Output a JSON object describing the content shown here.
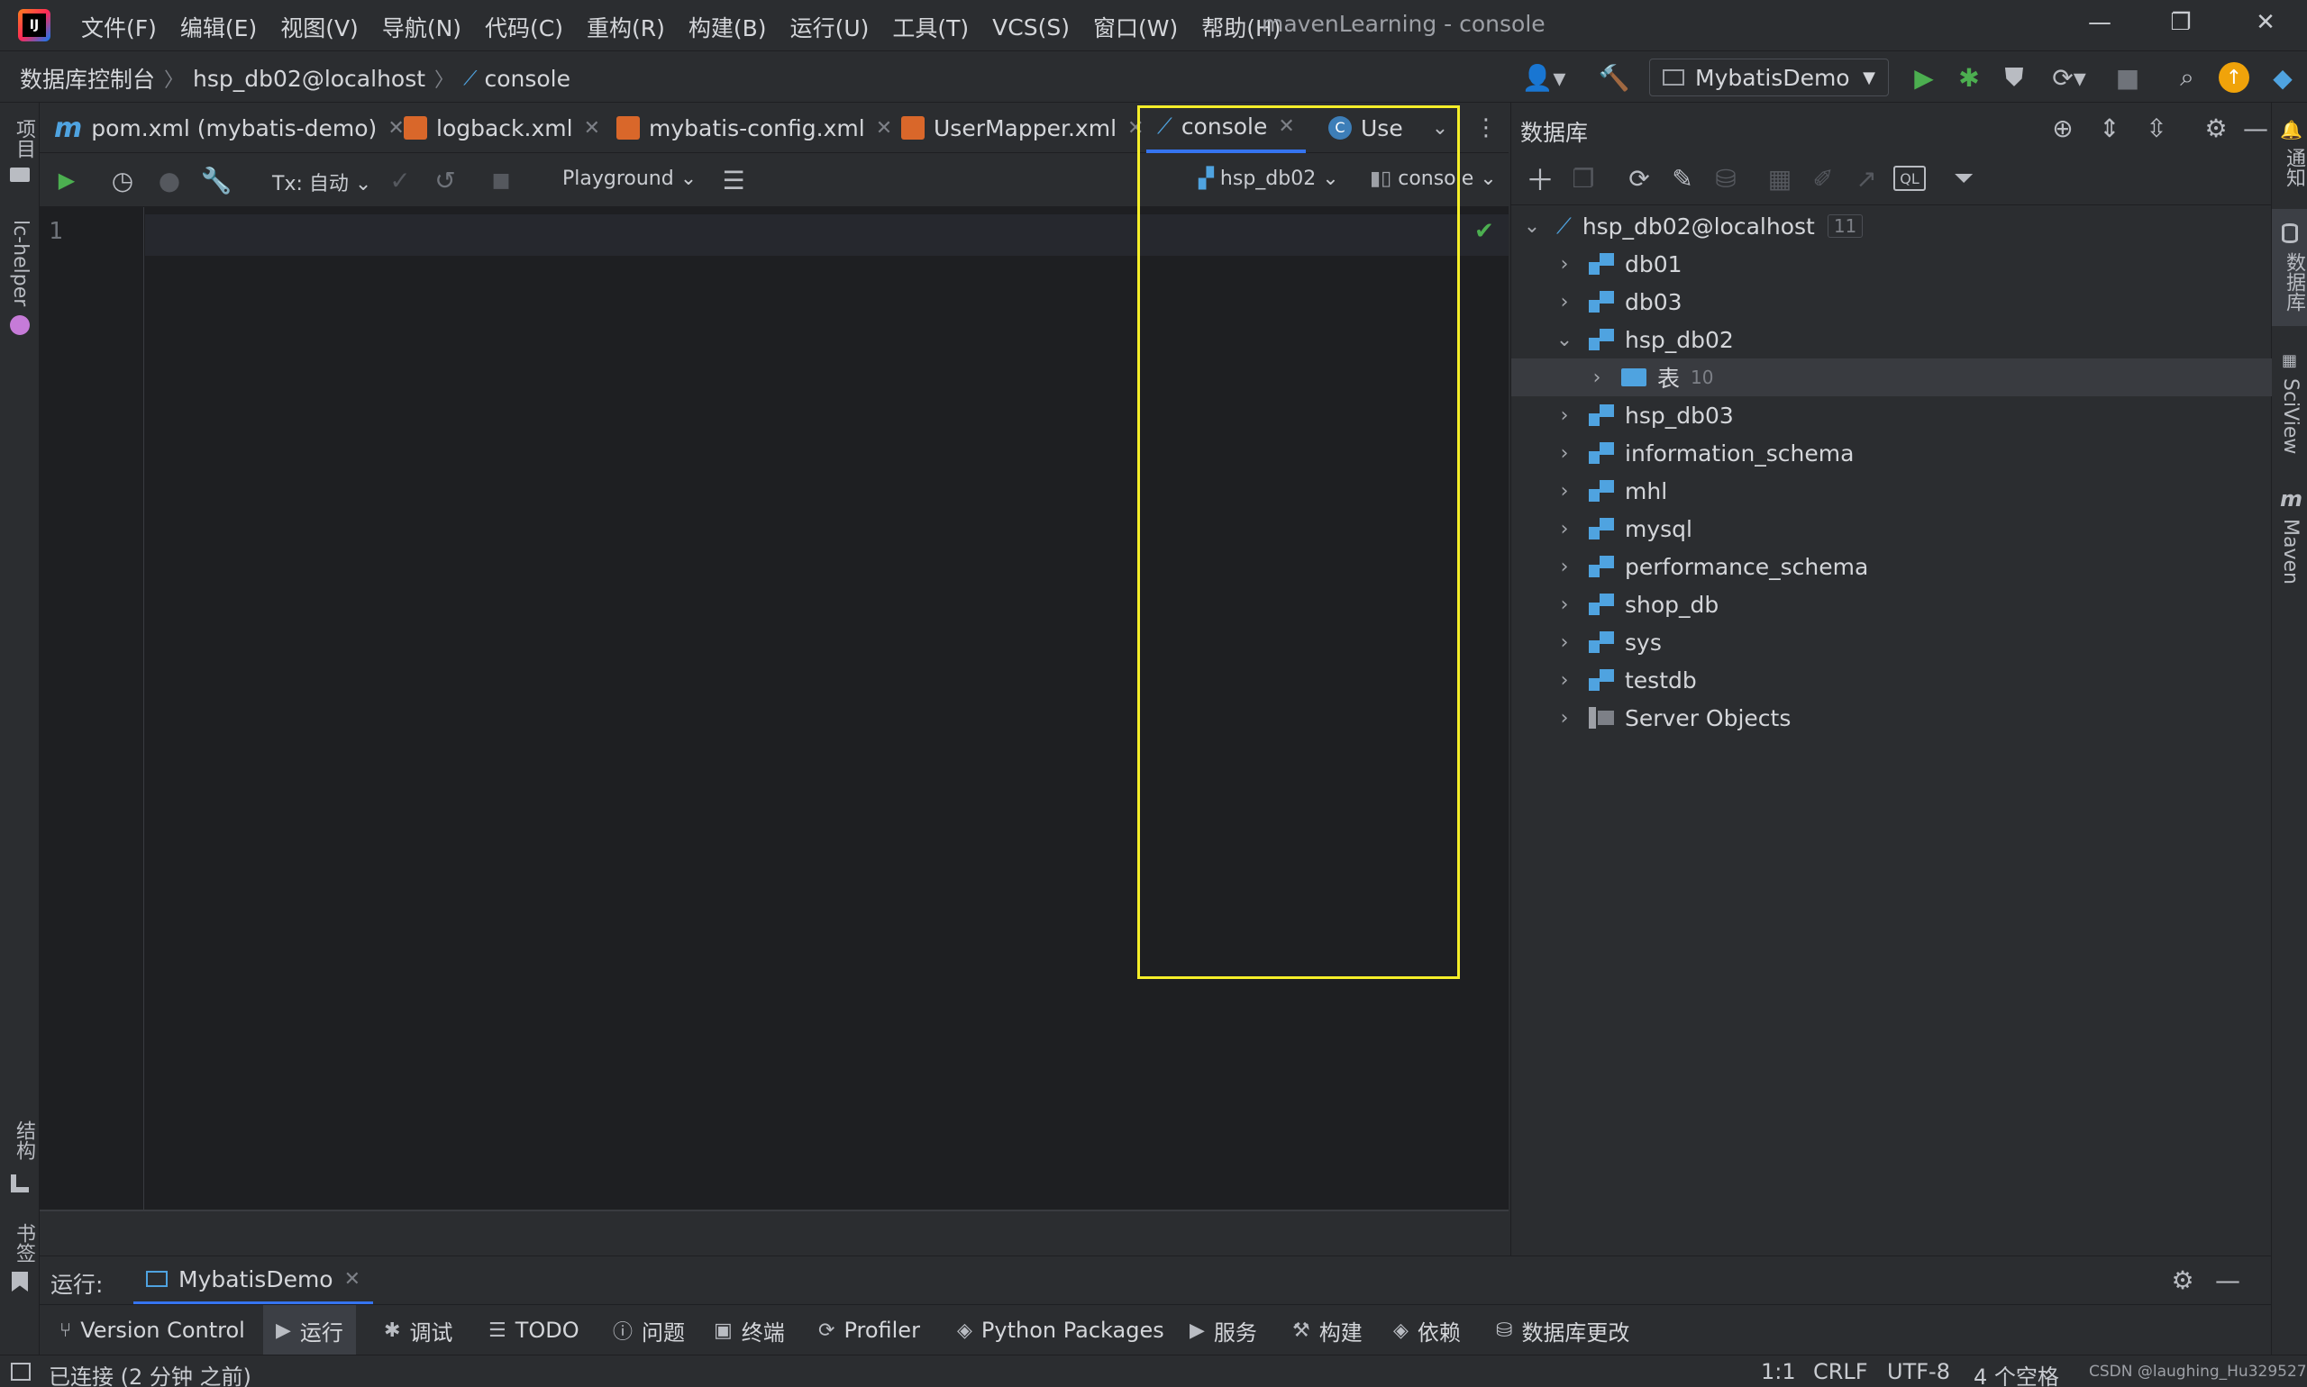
{
  "window": {
    "title": "mavenLearning - console",
    "menu": [
      "文件(F)",
      "编辑(E)",
      "视图(V)",
      "导航(N)",
      "代码(C)",
      "重构(R)",
      "构建(B)",
      "运行(U)",
      "工具(T)",
      "VCS(S)",
      "窗口(W)",
      "帮助(H)"
    ]
  },
  "breadcrumb": [
    "数据库控制台",
    "hsp_db02@localhost",
    "console"
  ],
  "run_config": "MybatisDemo",
  "left_strip": {
    "project": "项目",
    "plugin": "lc-helper",
    "structure": "结构",
    "bookmarks": "书签"
  },
  "right_strip": {
    "notifications": "通知",
    "database": "数据库",
    "sciview": "SciView",
    "maven": "Maven"
  },
  "tabs": [
    {
      "label": "pom.xml (mybatis-demo)",
      "icon": "maven-icon"
    },
    {
      "label": "logback.xml",
      "icon": "xml-icon"
    },
    {
      "label": "mybatis-config.xml",
      "icon": "xml-icon"
    },
    {
      "label": "UserMapper.xml",
      "icon": "xml-icon"
    },
    {
      "label": "console",
      "icon": "console-icon",
      "active": true
    },
    {
      "label": "Use",
      "icon": "class-icon"
    }
  ],
  "editor_toolbar": {
    "tx": "Tx: 自动",
    "playground": "Playground",
    "datasource": "hsp_db02",
    "session": "console"
  },
  "editor": {
    "line_number": "1"
  },
  "db_panel": {
    "title": "数据库",
    "root": {
      "label": "hsp_db02@localhost",
      "count": "11"
    },
    "items": [
      {
        "label": "db01",
        "expanded": false
      },
      {
        "label": "db03",
        "expanded": false
      },
      {
        "label": "hsp_db02",
        "expanded": true
      },
      {
        "label": "表",
        "count": "10",
        "child": true
      },
      {
        "label": "hsp_db03",
        "expanded": false
      },
      {
        "label": "information_schema",
        "expanded": false
      },
      {
        "label": "mhl",
        "expanded": false
      },
      {
        "label": "mysql",
        "expanded": false
      },
      {
        "label": "performance_schema",
        "expanded": false
      },
      {
        "label": "shop_db",
        "expanded": false
      },
      {
        "label": "sys",
        "expanded": false
      },
      {
        "label": "testdb",
        "expanded": false
      },
      {
        "label": "Server Objects",
        "expanded": false
      }
    ]
  },
  "run_bar": {
    "label": "运行:",
    "tab": "MybatisDemo"
  },
  "bottom_tools": [
    "Version Control",
    "运行",
    "调试",
    "TODO",
    "问题",
    "终端",
    "Profiler",
    "Python Packages",
    "服务",
    "构建",
    "依赖",
    "数据库更改"
  ],
  "status": {
    "left": "已连接 (2 分钟 之前)",
    "position": "1:1",
    "line_sep": "CRLF",
    "encoding": "UTF-8",
    "indent": "4 个空格",
    "watermark": "CSDN @laughing_Hu329527"
  },
  "colors": {
    "accent": "#3574f0",
    "highlight": "#f5ee29",
    "run_green": "#4caf50",
    "db_blue": "#4fa3e0"
  }
}
